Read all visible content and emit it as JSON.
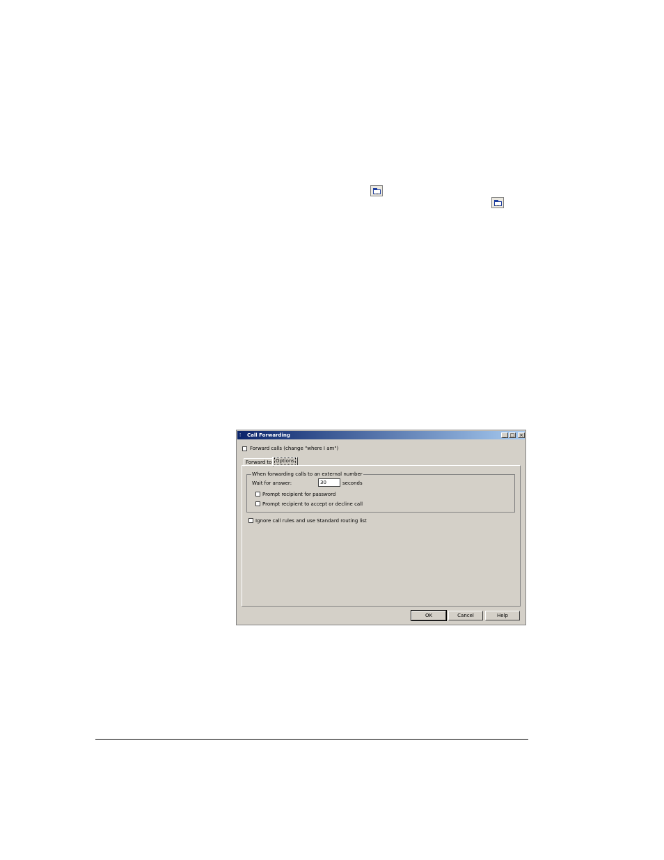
{
  "dialog": {
    "title": "Call Forwarding",
    "minimize": "_",
    "maximize": "□",
    "close": "×",
    "forward_calls_label": "Forward calls (change \"where I am\")",
    "tabs": [
      {
        "label": "Forward to",
        "active": false
      },
      {
        "label": "Options",
        "active": true
      }
    ],
    "group_title": "When forwarding calls to an external number",
    "wait_label": "Wait for answer:",
    "wait_value": "30",
    "seconds_label": "seconds",
    "prompt_password_label": "Prompt recipient for password",
    "prompt_accept_label": "Prompt recipient to accept or decline call",
    "ignore_rules_label": "Ignore call rules and use Standard routing list",
    "ok_label": "OK",
    "cancel_label": "Cancel",
    "help_label": "Help"
  },
  "colors": {
    "titlebar_start": "#0a246a",
    "titlebar_end": "#a6caf0",
    "dialog_face": "#d4d0c8"
  }
}
